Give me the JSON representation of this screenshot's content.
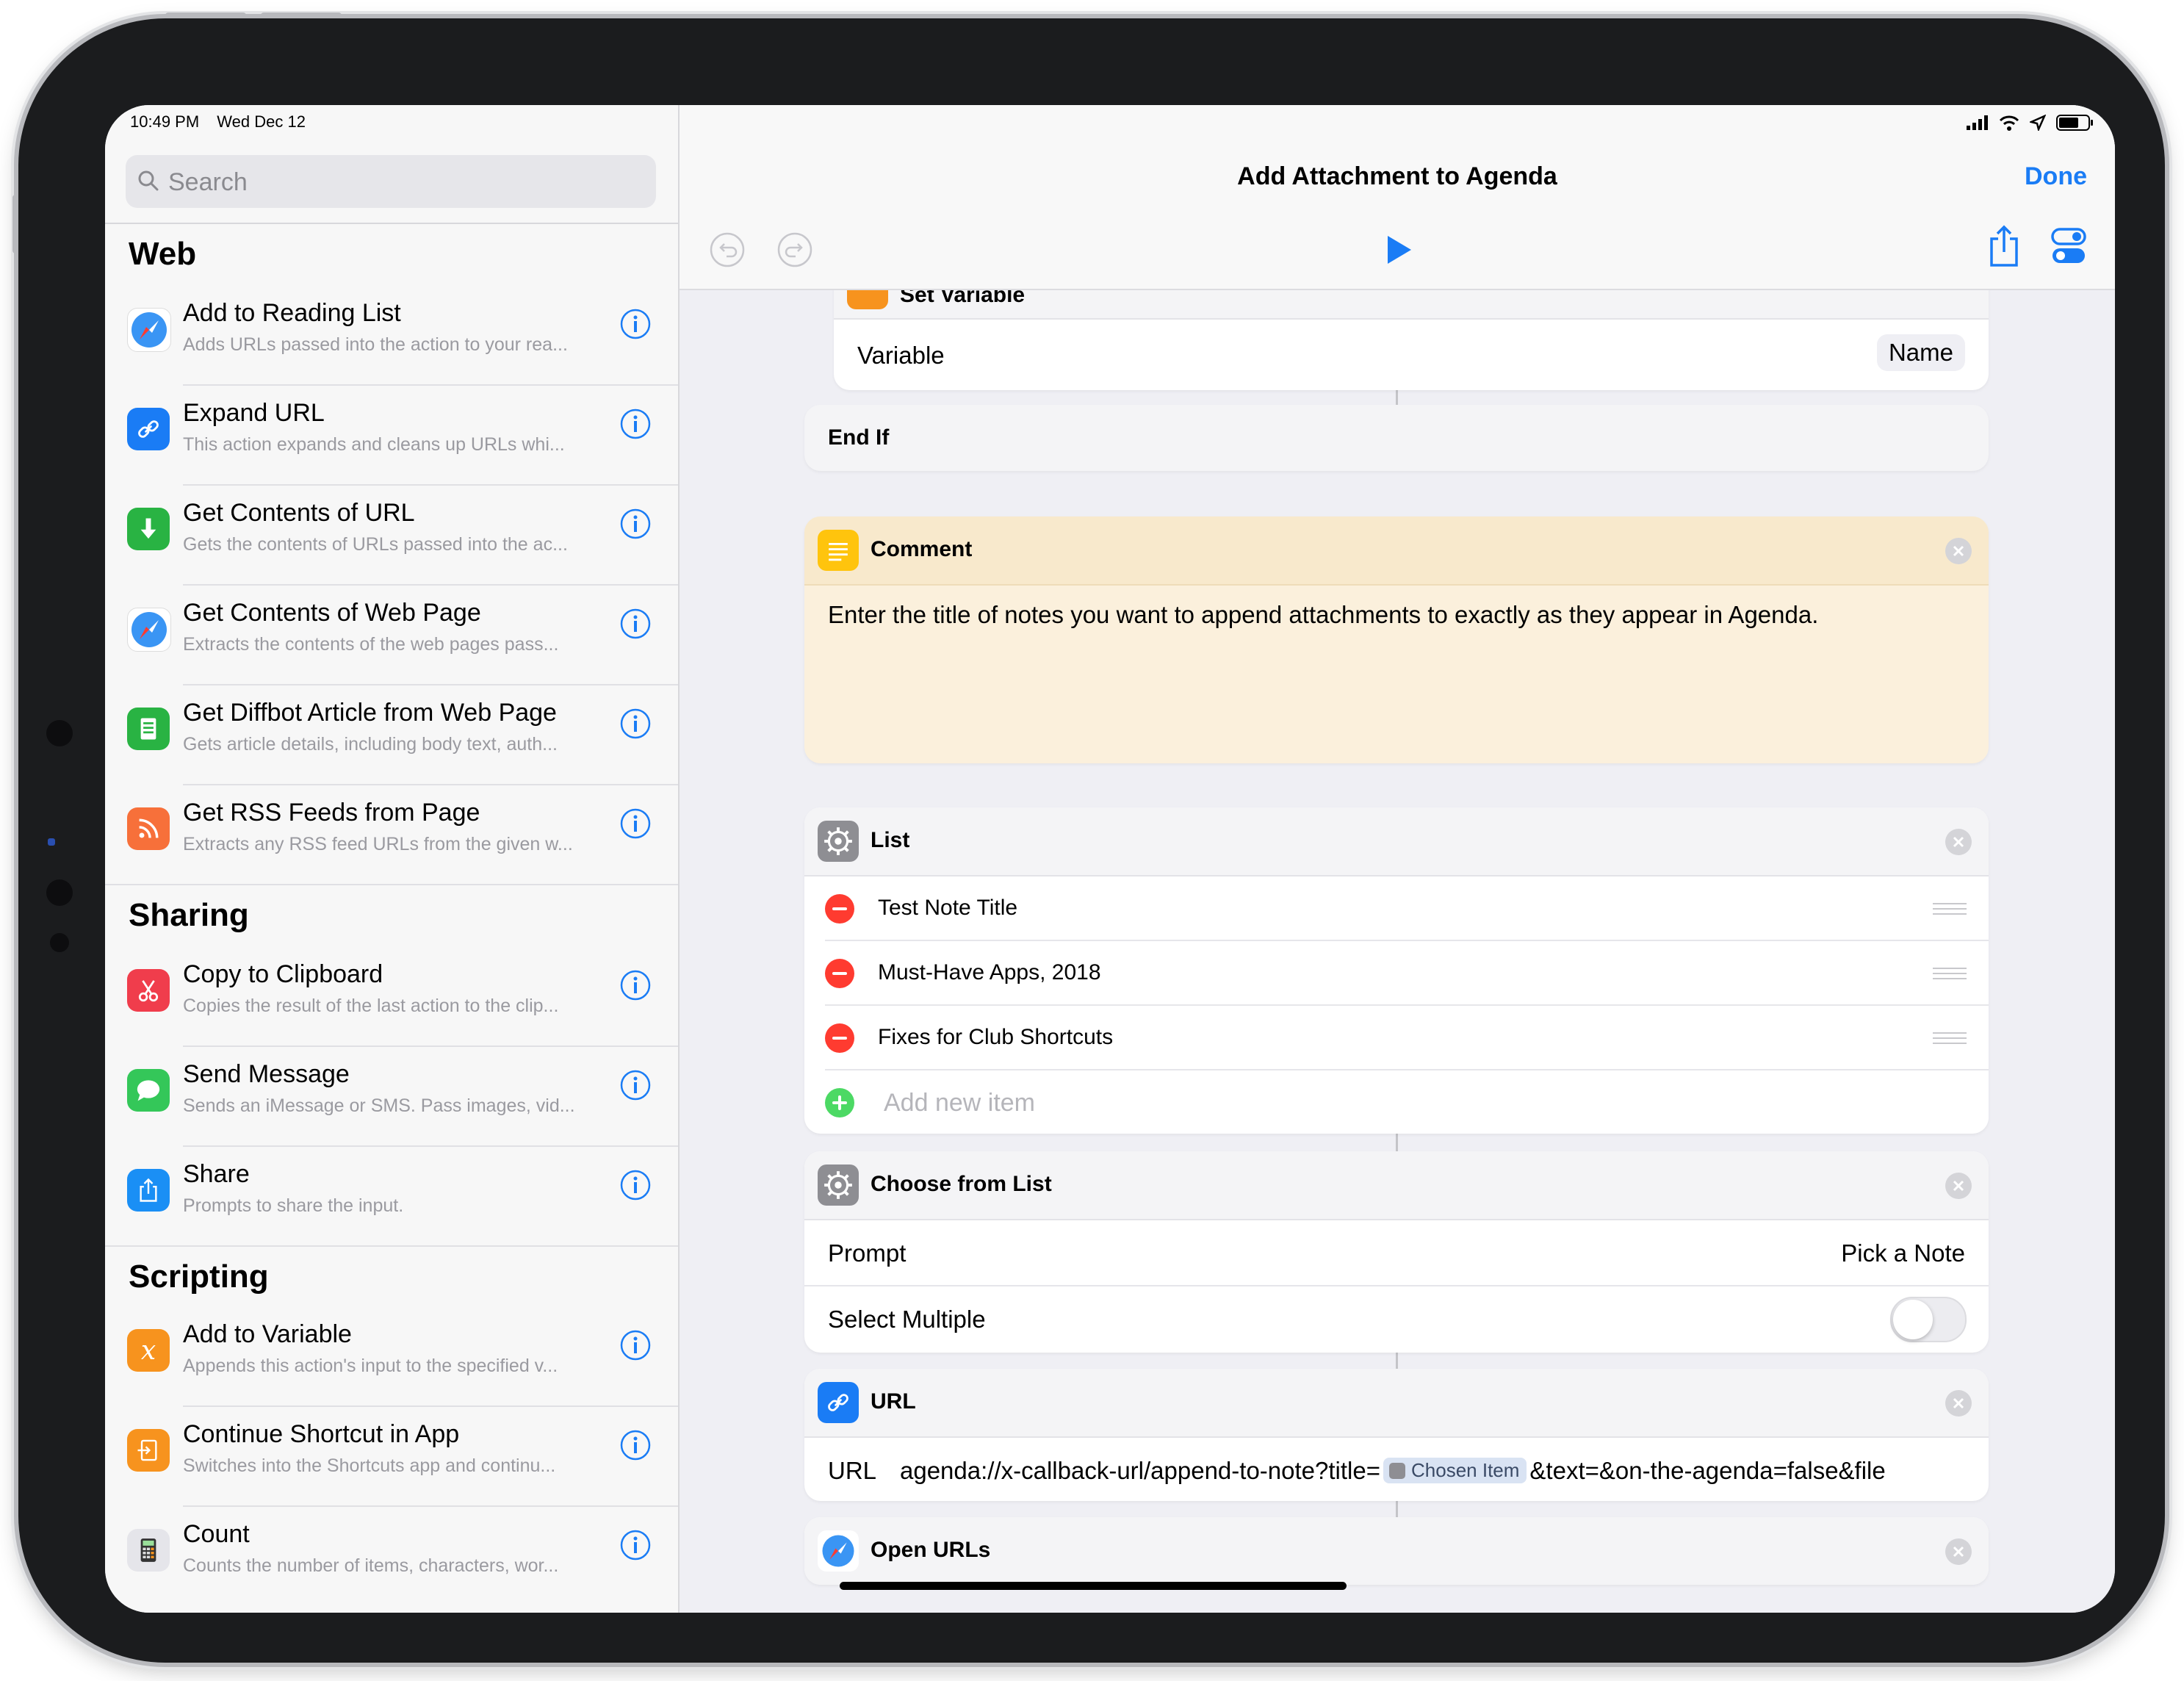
{
  "status": {
    "time": "10:49 PM",
    "date": "Wed Dec 12"
  },
  "search": {
    "placeholder": "Search"
  },
  "sections": {
    "web": "Web",
    "sharing": "Sharing",
    "scripting": "Scripting"
  },
  "actions": [
    {
      "title": "Add to Reading List",
      "desc": "Adds URLs passed into the action to your rea...",
      "icon": "safari-icon",
      "color": "#2f8af3"
    },
    {
      "title": "Expand URL",
      "desc": "This action expands and cleans up URLs whi...",
      "icon": "link-icon",
      "color": "#1a7cf5"
    },
    {
      "title": "Get Contents of URL",
      "desc": "Gets the contents of URLs passed into the ac...",
      "icon": "download-icon",
      "color": "#29b343"
    },
    {
      "title": "Get Contents of Web Page",
      "desc": "Extracts the contents of the web pages pass...",
      "icon": "safari-icon",
      "color": "#2f8af3"
    },
    {
      "title": "Get Diffbot Article from Web Page",
      "desc": "Gets article details, including body text, auth...",
      "icon": "article-icon",
      "color": "#29b343"
    },
    {
      "title": "Get RSS Feeds from Page",
      "desc": "Extracts any RSS feed URLs from the given w...",
      "icon": "rss-icon",
      "color": "#f7703a"
    },
    {
      "title": "Copy to Clipboard",
      "desc": "Copies the result of the last action to the clip...",
      "icon": "scissors-icon",
      "color": "#f03d4c"
    },
    {
      "title": "Send Message",
      "desc": "Sends an iMessage or SMS. Pass images, vid...",
      "icon": "message-icon",
      "color": "#34c759"
    },
    {
      "title": "Share",
      "desc": "Prompts to share the input.",
      "icon": "share-icon",
      "color": "#1a8ff5"
    },
    {
      "title": "Add to Variable",
      "desc": "Appends this action's input to the specified v...",
      "icon": "variable-icon",
      "color": "#f7931e"
    },
    {
      "title": "Continue Shortcut in App",
      "desc": "Switches into the Shortcuts app and continu...",
      "icon": "continue-icon",
      "color": "#f7931e"
    },
    {
      "title": "Count",
      "desc": "Counts the number of items, characters, wor...",
      "icon": "calculator-icon",
      "color": "#e5e5ea"
    }
  ],
  "editor": {
    "title": "Add Attachment to Agenda",
    "done": "Done",
    "set_variable": {
      "title": "Set Variable",
      "variable_label": "Variable",
      "variable_value": "Name"
    },
    "end_if": "End If",
    "comment": {
      "title": "Comment",
      "text": "Enter the title of notes you want to append attachments to exactly as they appear in Agenda."
    },
    "list": {
      "title": "List",
      "items": [
        "Test Note Title",
        "Must-Have Apps, 2018",
        "Fixes for Club Shortcuts"
      ],
      "add_placeholder": "Add new item"
    },
    "choose": {
      "title": "Choose from List",
      "prompt_label": "Prompt",
      "prompt_value": "Pick a Note",
      "multiple_label": "Select Multiple",
      "multiple_on": false
    },
    "url": {
      "title": "URL",
      "label": "URL",
      "prefix": "agenda://x-callback-url/append-to-note?title=",
      "token": "Chosen Item",
      "suffix": "&text=&on-the-agenda=false&file"
    },
    "open_urls": {
      "title": "Open URLs"
    }
  },
  "colors": {
    "accent": "#1a7cf5",
    "comment_bg": "#fbf0dc",
    "comment_head": "#f8e9cc"
  }
}
